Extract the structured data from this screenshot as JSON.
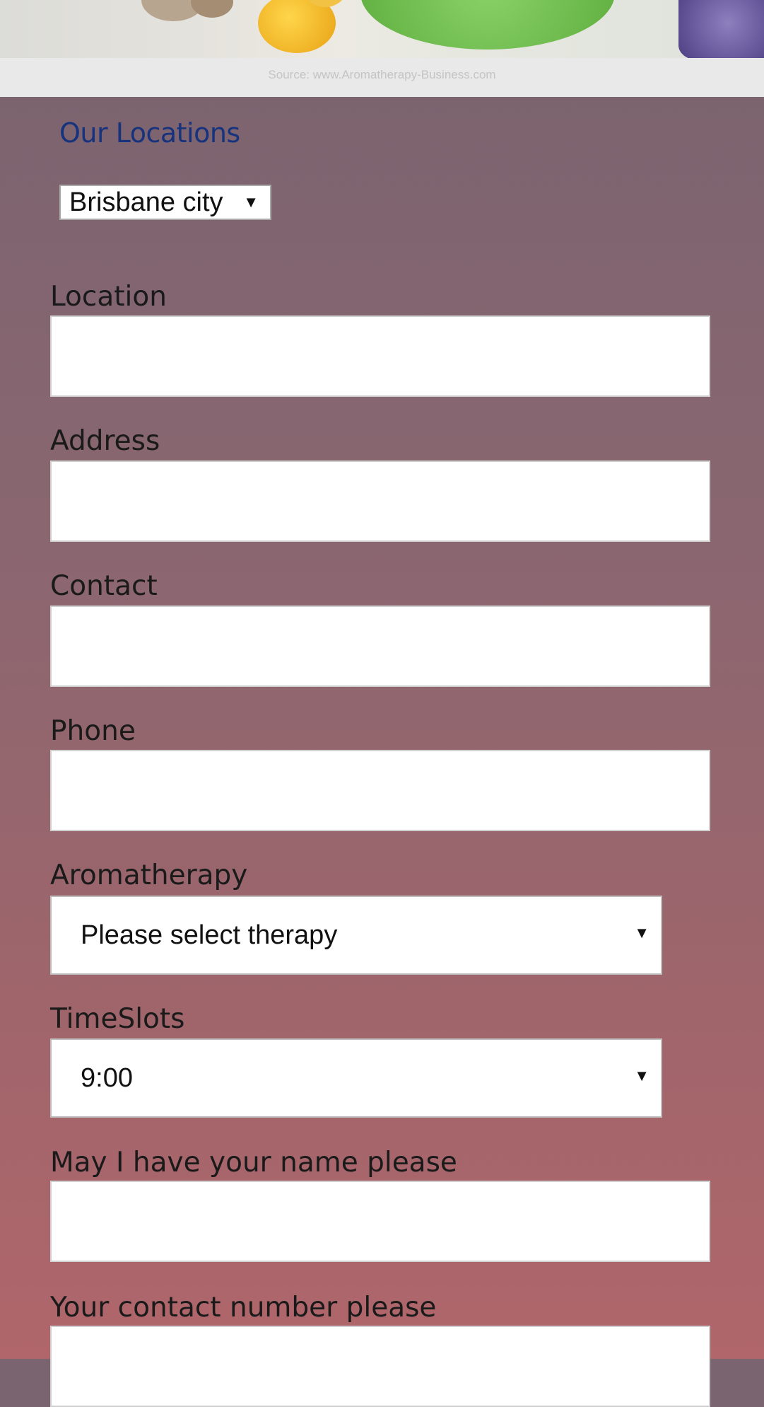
{
  "banner": {
    "source_caption": "Source: www.Aromatherapy-Business.com"
  },
  "locations": {
    "heading": "Our Locations",
    "city_select": {
      "selected": "Brisbane city"
    }
  },
  "form": {
    "location_label": "Location",
    "address_label": "Address",
    "contact_label": "Contact",
    "phone_label": "Phone",
    "aromatherapy_label": "Aromatherapy",
    "aromatherapy_selected": "Please select therapy",
    "timeslots_label": "TimeSlots",
    "timeslots_selected": "9:00",
    "name_label": "May I have your name please",
    "contact_number_label": "Your contact number please"
  },
  "icons": {
    "dropdown": "caret-down-icon"
  },
  "colors": {
    "heading": "#17337d",
    "background_top": "#79646f",
    "background_bottom": "#b0666b"
  }
}
